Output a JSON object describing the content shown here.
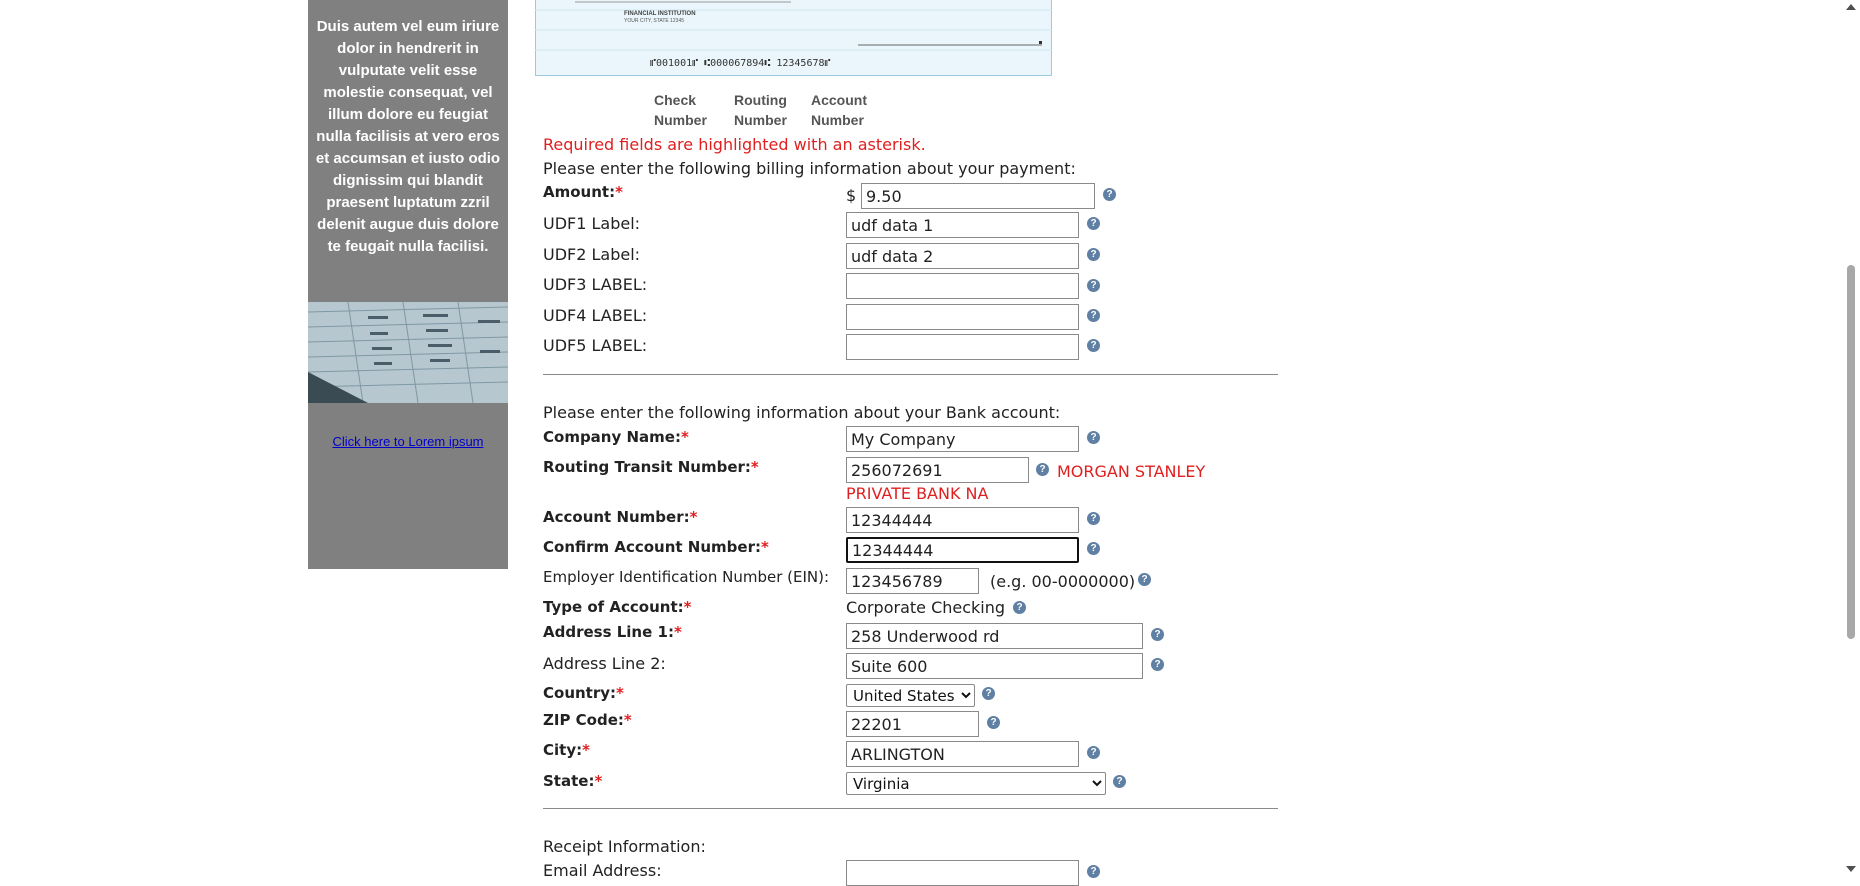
{
  "sidebar": {
    "text": "Duis autem vel eum iriure dolor in hendrerit in vulputate velit esse molestie consequat, vel illum dolore eu feugiat nulla facilisis at vero eros et accumsan et iusto odio dignissim qui blandit praesent luptatum zzril delenit augue duis dolore te feugait nulla facilisi.",
    "link": "Click here to Lorem ipsum"
  },
  "check": {
    "institution": "FINANCIAL INSTITUTION",
    "address": "YOUR CITY, STATE 12345",
    "micr": "⑈001001⑈ ⑆000067894⑆ 12345678⑈",
    "captions": [
      [
        "Check",
        "Number"
      ],
      [
        "Routing",
        "Number"
      ],
      [
        "Account",
        "Number"
      ]
    ]
  },
  "required_note": "Required fields are highlighted with an asterisk.",
  "billing": {
    "intro": "Please enter the following billing information about your payment:",
    "amount_label": "Amount:",
    "currency": "$",
    "amount": "9.50",
    "udf": [
      {
        "label": "UDF1 Label:",
        "value": "udf data 1"
      },
      {
        "label": "UDF2 Label:",
        "value": "udf data 2"
      },
      {
        "label": "UDF3 LABEL:",
        "value": ""
      },
      {
        "label": "UDF4 LABEL:",
        "value": ""
      },
      {
        "label": "UDF5 LABEL:",
        "value": ""
      }
    ]
  },
  "bank": {
    "intro": "Please enter the following information about your Bank account:",
    "company_label": "Company Name:",
    "company": "My Company",
    "routing_label": "Routing Transit Number:",
    "routing": "256072691",
    "bank_name_line1": "MORGAN STANLEY",
    "bank_name_line2": "PRIVATE BANK NA",
    "account_label": "Account Number:",
    "account": "12344444",
    "confirm_label": "Confirm Account Number:",
    "confirm": "12344444",
    "ein_label": "Employer Identification Number (EIN):",
    "ein": "123456789",
    "ein_hint": "(e.g. 00-0000000)",
    "type_label": "Type of Account:",
    "type": "Corporate Checking",
    "addr1_label": "Address Line 1:",
    "addr1": "258 Underwood rd",
    "addr2_label": "Address Line 2:",
    "addr2": "Suite 600",
    "country_label": "Country:",
    "country": "United States",
    "zip_label": "ZIP Code:",
    "zip": "22201",
    "city_label": "City:",
    "city": "ARLINGTON",
    "state_label": "State:",
    "state": "Virginia"
  },
  "receipt": {
    "heading": "Receipt Information:",
    "email_label": "Email Address:",
    "email": ""
  },
  "ui": {
    "asterisk": "*",
    "help_glyph": "?"
  },
  "colors": {
    "sidebar_bg": "#808080",
    "required_red": "#e02020",
    "help_icon": "#5f7fa3",
    "link": "#0000cc"
  }
}
